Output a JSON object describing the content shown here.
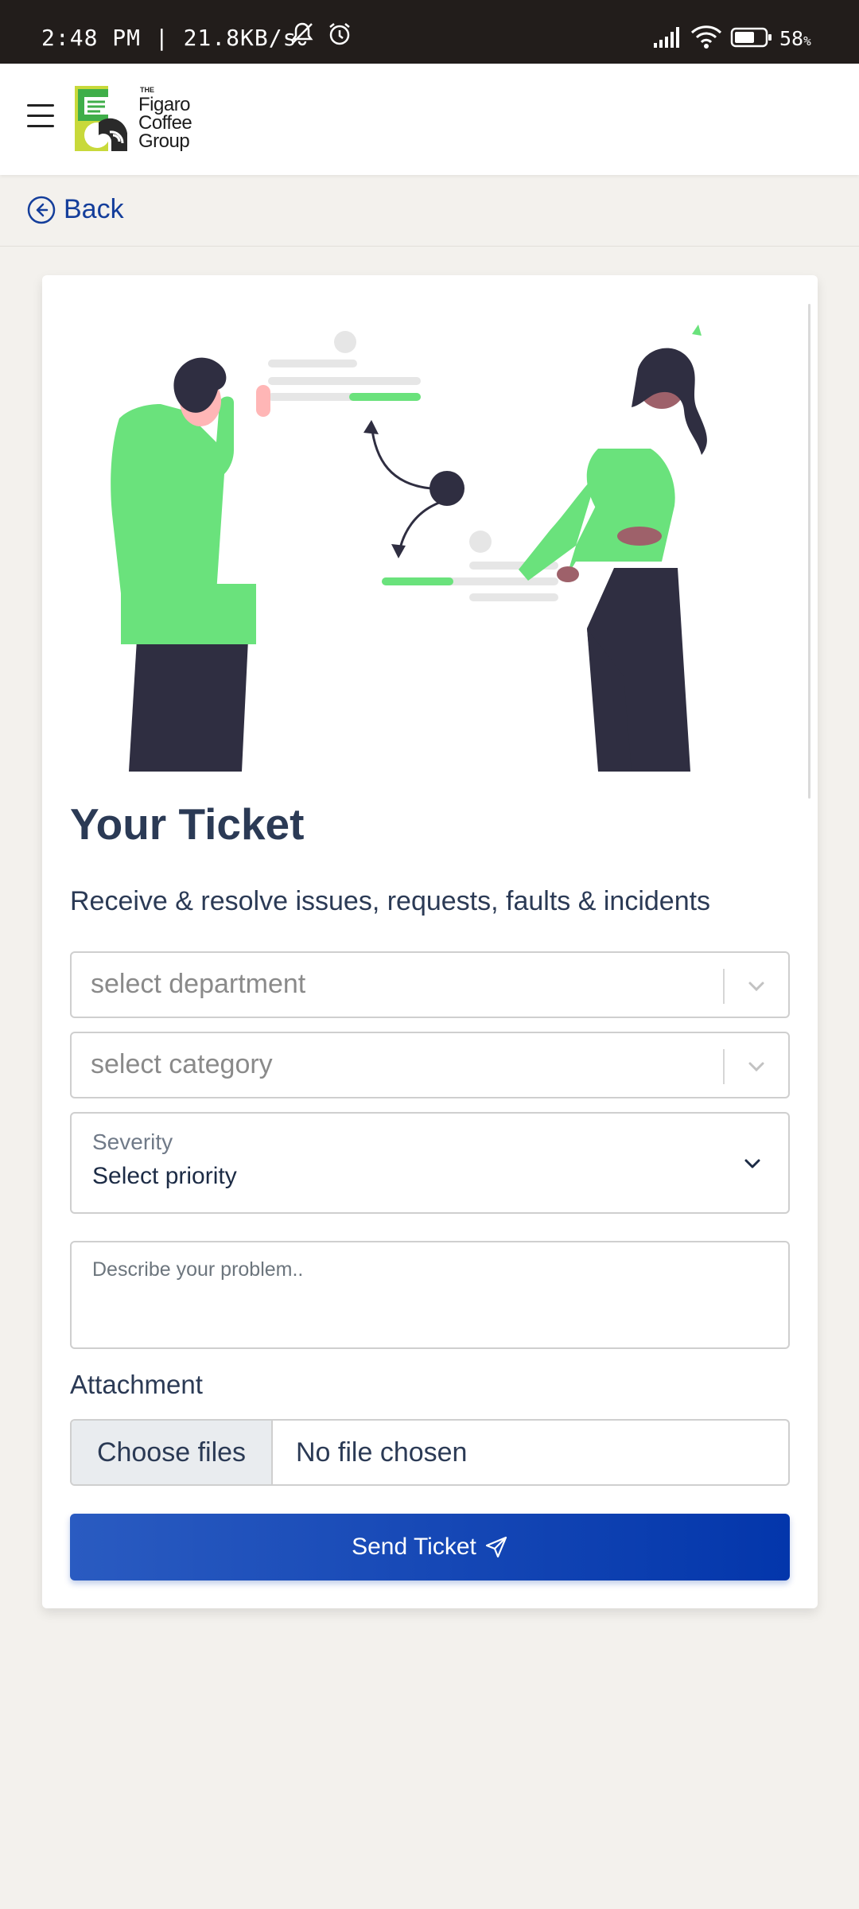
{
  "status_bar": {
    "time": "2:48 PM | 21.8KB/s",
    "battery_percent": "58",
    "battery_suffix": "%"
  },
  "header": {
    "brand": {
      "the": "THE",
      "line1": "Figaro",
      "line2": "Coffee",
      "line3": "Group"
    }
  },
  "nav": {
    "back_label": "Back"
  },
  "ticket": {
    "title": "Your Ticket",
    "subtitle": "Receive & resolve issues, requests, faults & incidents",
    "department_placeholder": "select department",
    "category_placeholder": "select category",
    "severity_label": "Severity",
    "severity_value": "Select priority",
    "description_placeholder": "Describe your problem..",
    "attachment_label": "Attachment",
    "choose_files_label": "Choose files",
    "file_status": "No file chosen",
    "send_label": "Send Ticket"
  },
  "colors": {
    "accent": "#0336ab",
    "brand_green": "#6ae27c",
    "background": "#f3f1ed"
  },
  "icons": {
    "menu": "hamburger-icon",
    "back": "arrow-left-circle-icon",
    "dropdown": "chevron-down-icon",
    "send": "paper-plane-icon"
  }
}
